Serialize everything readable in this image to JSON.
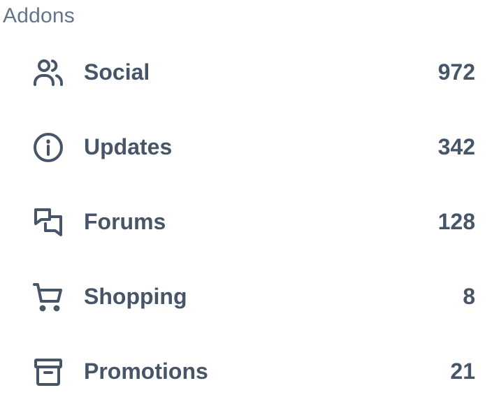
{
  "section": {
    "title": "Addons"
  },
  "items": [
    {
      "label": "Social",
      "count": "972",
      "icon": "users-icon"
    },
    {
      "label": "Updates",
      "count": "342",
      "icon": "info-circle-icon"
    },
    {
      "label": "Forums",
      "count": "128",
      "icon": "chat-bubbles-icon"
    },
    {
      "label": "Shopping",
      "count": "8",
      "icon": "shopping-cart-icon"
    },
    {
      "label": "Promotions",
      "count": "21",
      "icon": "archive-box-icon"
    }
  ],
  "colors": {
    "text": "#475569",
    "title": "#64748b",
    "background": "#ffffff"
  }
}
